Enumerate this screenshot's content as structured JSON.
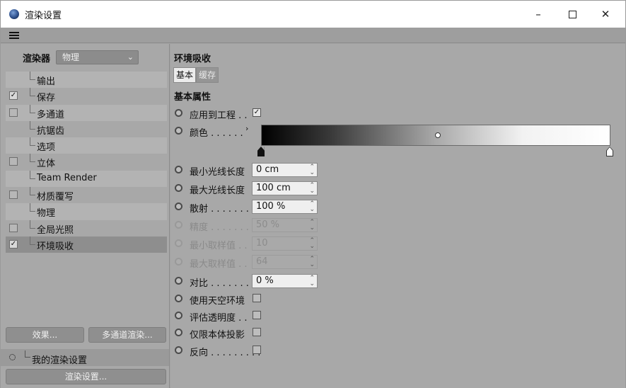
{
  "window": {
    "title": "渲染设置",
    "minimize_glyph": "–",
    "close_glyph": "✕"
  },
  "renderer": {
    "label": "渲染器",
    "selected": "物理"
  },
  "tree": [
    {
      "label": "输出",
      "checkbox": false,
      "checked": false
    },
    {
      "label": "保存",
      "checkbox": true,
      "checked": true
    },
    {
      "label": "多通道",
      "checkbox": true,
      "checked": false
    },
    {
      "label": "抗锯齿",
      "checkbox": false,
      "checked": false
    },
    {
      "label": "选项",
      "checkbox": false,
      "checked": false
    },
    {
      "label": "立体",
      "checkbox": true,
      "checked": false
    },
    {
      "label": "Team Render",
      "checkbox": false,
      "checked": false
    },
    {
      "label": "材质覆写",
      "checkbox": true,
      "checked": false
    },
    {
      "label": "物理",
      "checkbox": false,
      "checked": false
    },
    {
      "label": "全局光照",
      "checkbox": true,
      "checked": false
    },
    {
      "label": "环境吸收",
      "checkbox": true,
      "checked": true,
      "selected": true
    }
  ],
  "left_buttons": {
    "effect": "效果...",
    "multipass": "多通道渲染..."
  },
  "my_settings": "我的渲染设置",
  "render_settings_button": "渲染设置...",
  "section": {
    "title": "环境吸收",
    "tabs": [
      "基本",
      "缓存"
    ],
    "subsection": "基本属性"
  },
  "props": {
    "apply_to_project": {
      "label": "应用到工程 . .",
      "checked": true
    },
    "color": {
      "label": "颜色 . . . . . ."
    },
    "min_ray_length": {
      "label": "最小光线长度",
      "value": "0 cm"
    },
    "max_ray_length": {
      "label": "最大光线长度",
      "value": "100 cm"
    },
    "dispersion": {
      "label": "散射 . . . . . . . . .",
      "value": "100 %"
    },
    "accuracy": {
      "label": "精度 . . . . . . . . .",
      "value": "50 %"
    },
    "min_samples": {
      "label": "最小取样值 . .",
      "value": "10"
    },
    "max_samples": {
      "label": "最大取样值 . .",
      "value": "64"
    },
    "contrast": {
      "label": "对比 . . . . . . . . .",
      "value": "0 %"
    },
    "use_sky": {
      "label": "使用天空环境",
      "checked": false
    },
    "eval_transparency": {
      "label": "评估透明度 . .",
      "checked": false
    },
    "self_shadow_only": {
      "label": "仅限本体投影",
      "checked": false
    },
    "invert": {
      "label": "反向 . . . . . . . . .",
      "checked": false
    }
  },
  "icons": {
    "app": "cinema4d-sphere-icon",
    "menu": "hamburger-menu-icon"
  }
}
